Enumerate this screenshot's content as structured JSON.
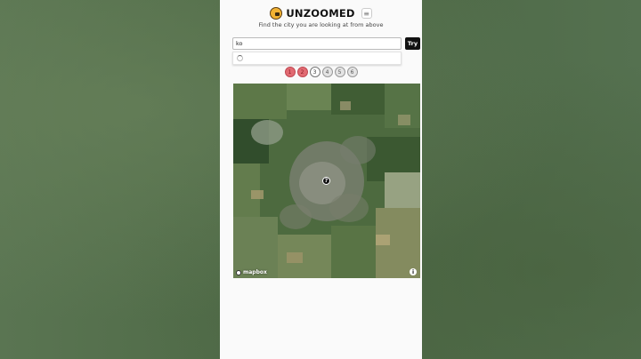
{
  "header": {
    "title": "UNZOOMED",
    "subtitle": "Find the city you are looking at from above",
    "logo_icon": "eye-puzzle-icon",
    "menu_icon": "hamburger-menu-icon",
    "menu_glyph": "≡"
  },
  "search": {
    "value": "ko",
    "try_label": "Try"
  },
  "dropdown": {
    "loading_icon": "loading-spinner-icon"
  },
  "attempts": [
    {
      "label": "1",
      "state": "used"
    },
    {
      "label": "2",
      "state": "used"
    },
    {
      "label": "3",
      "state": "current"
    },
    {
      "label": "4",
      "state": "pending"
    },
    {
      "label": "5",
      "state": "pending"
    },
    {
      "label": "6",
      "state": "pending"
    }
  ],
  "map": {
    "marker_label": "?",
    "attribution": "mapbox",
    "info_label": "i"
  },
  "colors": {
    "attempt_used": "#e26a72",
    "accent_dark": "#111111",
    "background_green": "#4f6a47"
  }
}
